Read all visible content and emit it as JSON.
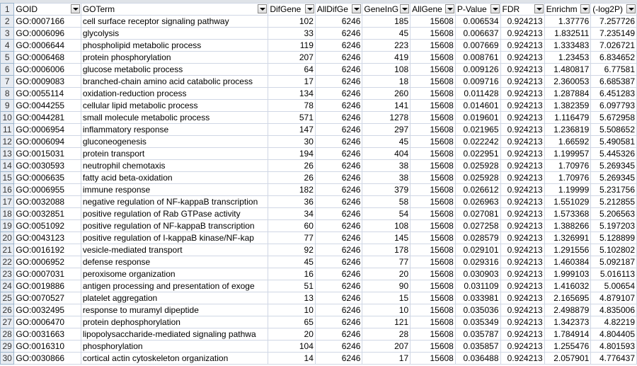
{
  "headers": [
    "GOID",
    "GOTerm",
    "DifGene",
    "AllDifGe",
    "GeneInG",
    "AllGene",
    "P-Value",
    "FDR",
    "Enrichm",
    "(-log2P)"
  ],
  "rows": [
    [
      "GO:0007166",
      "cell surface receptor signaling pathway",
      "102",
      "6246",
      "185",
      "15608",
      "0.006534",
      "0.924213",
      "1.37776",
      "7.257726"
    ],
    [
      "GO:0006096",
      "glycolysis",
      "33",
      "6246",
      "45",
      "15608",
      "0.006637",
      "0.924213",
      "1.832511",
      "7.235149"
    ],
    [
      "GO:0006644",
      "phospholipid metabolic process",
      "119",
      "6246",
      "223",
      "15608",
      "0.007669",
      "0.924213",
      "1.333483",
      "7.026721"
    ],
    [
      "GO:0006468",
      "protein phosphorylation",
      "207",
      "6246",
      "419",
      "15608",
      "0.008761",
      "0.924213",
      "1.23453",
      "6.834652"
    ],
    [
      "GO:0006006",
      "glucose metabolic process",
      "64",
      "6246",
      "108",
      "15608",
      "0.009126",
      "0.924213",
      "1.480817",
      "6.77581"
    ],
    [
      "GO:0009083",
      "branched-chain amino acid catabolic process",
      "17",
      "6246",
      "18",
      "15608",
      "0.009716",
      "0.924213",
      "2.360053",
      "6.685387"
    ],
    [
      "GO:0055114",
      "oxidation-reduction process",
      "134",
      "6246",
      "260",
      "15608",
      "0.011428",
      "0.924213",
      "1.287884",
      "6.451283"
    ],
    [
      "GO:0044255",
      "cellular lipid metabolic process",
      "78",
      "6246",
      "141",
      "15608",
      "0.014601",
      "0.924213",
      "1.382359",
      "6.097793"
    ],
    [
      "GO:0044281",
      "small molecule metabolic process",
      "571",
      "6246",
      "1278",
      "15608",
      "0.019601",
      "0.924213",
      "1.116479",
      "5.672958"
    ],
    [
      "GO:0006954",
      "inflammatory response",
      "147",
      "6246",
      "297",
      "15608",
      "0.021965",
      "0.924213",
      "1.236819",
      "5.508652"
    ],
    [
      "GO:0006094",
      "gluconeogenesis",
      "30",
      "6246",
      "45",
      "15608",
      "0.022242",
      "0.924213",
      "1.66592",
      "5.490581"
    ],
    [
      "GO:0015031",
      "protein transport",
      "194",
      "6246",
      "404",
      "15608",
      "0.022951",
      "0.924213",
      "1.199957",
      "5.445326"
    ],
    [
      "GO:0030593",
      "neutrophil chemotaxis",
      "26",
      "6246",
      "38",
      "15608",
      "0.025928",
      "0.924213",
      "1.70976",
      "5.269345"
    ],
    [
      "GO:0006635",
      "fatty acid beta-oxidation",
      "26",
      "6246",
      "38",
      "15608",
      "0.025928",
      "0.924213",
      "1.70976",
      "5.269345"
    ],
    [
      "GO:0006955",
      "immune response",
      "182",
      "6246",
      "379",
      "15608",
      "0.026612",
      "0.924213",
      "1.19999",
      "5.231756"
    ],
    [
      "GO:0032088",
      "negative regulation of NF-kappaB transcription",
      "36",
      "6246",
      "58",
      "15608",
      "0.026963",
      "0.924213",
      "1.551029",
      "5.212855"
    ],
    [
      "GO:0032851",
      "positive regulation of Rab GTPase activity",
      "34",
      "6246",
      "54",
      "15608",
      "0.027081",
      "0.924213",
      "1.573368",
      "5.206563"
    ],
    [
      "GO:0051092",
      "positive regulation of NF-kappaB transcription",
      "60",
      "6246",
      "108",
      "15608",
      "0.027258",
      "0.924213",
      "1.388266",
      "5.197203"
    ],
    [
      "GO:0043123",
      "positive regulation of I-kappaB kinase/NF-kap",
      "77",
      "6246",
      "145",
      "15608",
      "0.028579",
      "0.924213",
      "1.326991",
      "5.128899"
    ],
    [
      "GO:0016192",
      "vesicle-mediated transport",
      "92",
      "6246",
      "178",
      "15608",
      "0.029101",
      "0.924213",
      "1.291556",
      "5.102802"
    ],
    [
      "GO:0006952",
      "defense response",
      "45",
      "6246",
      "77",
      "15608",
      "0.029316",
      "0.924213",
      "1.460384",
      "5.092187"
    ],
    [
      "GO:0007031",
      "peroxisome organization",
      "16",
      "6246",
      "20",
      "15608",
      "0.030903",
      "0.924213",
      "1.999103",
      "5.016113"
    ],
    [
      "GO:0019886",
      "antigen processing and presentation of exoge",
      "51",
      "6246",
      "90",
      "15608",
      "0.031109",
      "0.924213",
      "1.416032",
      "5.00654"
    ],
    [
      "GO:0070527",
      "platelet aggregation",
      "13",
      "6246",
      "15",
      "15608",
      "0.033981",
      "0.924213",
      "2.165695",
      "4.879107"
    ],
    [
      "GO:0032495",
      "response to muramyl dipeptide",
      "10",
      "6246",
      "10",
      "15608",
      "0.035036",
      "0.924213",
      "2.498879",
      "4.835006"
    ],
    [
      "GO:0006470",
      "protein dephosphorylation",
      "65",
      "6246",
      "121",
      "15608",
      "0.035349",
      "0.924213",
      "1.342373",
      "4.82219"
    ],
    [
      "GO:0031663",
      "lipopolysaccharide-mediated signaling pathwa",
      "20",
      "6246",
      "28",
      "15608",
      "0.035787",
      "0.924213",
      "1.784914",
      "4.804405"
    ],
    [
      "GO:0016310",
      "phosphorylation",
      "104",
      "6246",
      "207",
      "15608",
      "0.035857",
      "0.924213",
      "1.255476",
      "4.801593"
    ],
    [
      "GO:0030866",
      "cortical actin cytoskeleton organization",
      "14",
      "6246",
      "17",
      "15608",
      "0.036488",
      "0.924213",
      "2.057901",
      "4.776437"
    ]
  ]
}
